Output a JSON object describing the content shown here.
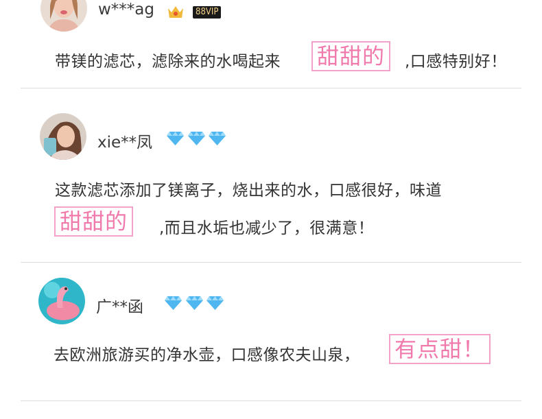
{
  "reviews": [
    {
      "username": "w***ag",
      "vip_badge": "88VIP",
      "text_before": "带镁的滤芯，滤除来的水喝起来",
      "highlight": "甜甜的",
      "text_after": ",口感特别好！"
    },
    {
      "username": "xie**凤",
      "text_line1": "这款滤芯添加了镁离子，烧出来的水，口感很好，味道",
      "highlight": "甜甜的",
      "text_after": ",而且水垢也减少了，很满意！"
    },
    {
      "username": "广**函",
      "text_before": "去欧洲旅游买的净水壶，口感像农夫山泉，",
      "highlight": "有点甜！"
    }
  ],
  "colors": {
    "highlight_text": "#f07aac",
    "highlight_border": "#f2a1c8",
    "gem": "#4fb6f0",
    "crown": "#f3b93c"
  },
  "icons": [
    "crown-icon",
    "diamond-icon"
  ]
}
